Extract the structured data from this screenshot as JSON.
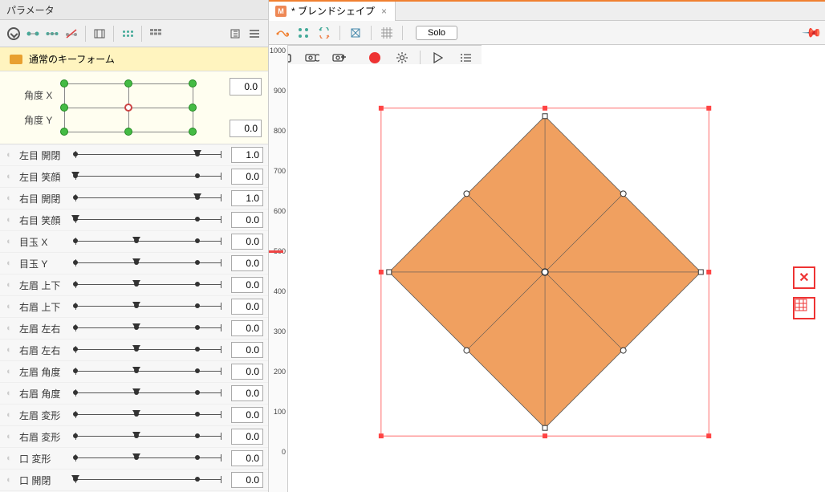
{
  "panel_title": "パラメータ",
  "folder_label": "通常のキーフォーム",
  "angle": {
    "x_label": "角度 X",
    "y_label": "角度 Y",
    "x_value": "0.0",
    "y_value": "0.0"
  },
  "params": [
    {
      "label": "左目 開閉",
      "value": "1.0",
      "pos": 100,
      "ticks": [
        0,
        100
      ]
    },
    {
      "label": "左目 笑顔",
      "value": "0.0",
      "pos": 0,
      "ticks": [
        0,
        100
      ]
    },
    {
      "label": "右目 開閉",
      "value": "1.0",
      "pos": 100,
      "ticks": [
        0,
        100
      ]
    },
    {
      "label": "右目 笑顔",
      "value": "0.0",
      "pos": 0,
      "ticks": [
        0,
        100
      ]
    },
    {
      "label": "目玉 X",
      "value": "0.0",
      "pos": 50,
      "ticks": [
        0,
        50,
        100
      ]
    },
    {
      "label": "目玉 Y",
      "value": "0.0",
      "pos": 50,
      "ticks": [
        0,
        50,
        100
      ]
    },
    {
      "label": "左眉 上下",
      "value": "0.0",
      "pos": 50,
      "ticks": [
        0,
        50,
        100
      ]
    },
    {
      "label": "右眉 上下",
      "value": "0.0",
      "pos": 50,
      "ticks": [
        0,
        50,
        100
      ]
    },
    {
      "label": "左眉 左右",
      "value": "0.0",
      "pos": 50,
      "ticks": [
        0,
        50,
        100
      ]
    },
    {
      "label": "右眉 左右",
      "value": "0.0",
      "pos": 50,
      "ticks": [
        0,
        50,
        100
      ]
    },
    {
      "label": "左眉 角度",
      "value": "0.0",
      "pos": 50,
      "ticks": [
        0,
        50,
        100
      ]
    },
    {
      "label": "右眉 角度",
      "value": "0.0",
      "pos": 50,
      "ticks": [
        0,
        50,
        100
      ]
    },
    {
      "label": "左眉 変形",
      "value": "0.0",
      "pos": 50,
      "ticks": [
        0,
        50,
        100
      ]
    },
    {
      "label": "右眉 変形",
      "value": "0.0",
      "pos": 50,
      "ticks": [
        0,
        50,
        100
      ]
    },
    {
      "label": "口 変形",
      "value": "0.0",
      "pos": 50,
      "ticks": [
        0,
        50,
        100
      ]
    },
    {
      "label": "口 開閉",
      "value": "0.0",
      "pos": 0,
      "ticks": [
        0,
        100
      ]
    }
  ],
  "canvas_tab": {
    "title": "* ブレンドシェイプ"
  },
  "solo_label": "Solo",
  "ruler_y": [
    "1000",
    "900",
    "800",
    "700",
    "600",
    "500",
    "400",
    "300",
    "200",
    "100",
    "0"
  ]
}
